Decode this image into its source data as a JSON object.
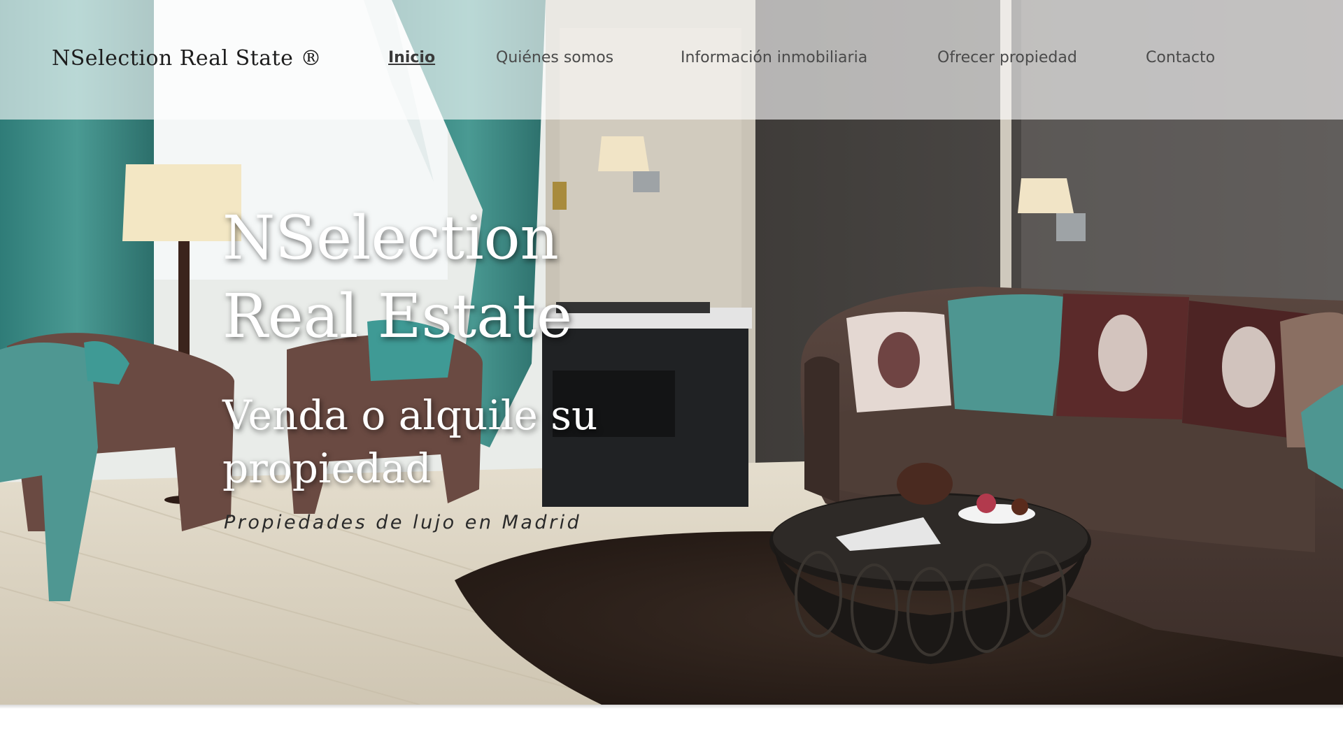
{
  "header": {
    "logo": "NSelection Real State ®",
    "nav": [
      {
        "label": "Inicio",
        "active": true
      },
      {
        "label": "Quiénes somos",
        "active": false
      },
      {
        "label": "Información inmobiliaria",
        "active": false
      },
      {
        "label": "Ofrecer propiedad",
        "active": false
      },
      {
        "label": "Contacto",
        "active": false
      }
    ]
  },
  "hero": {
    "title_line1": "NSelection",
    "title_line2": "Real Estate",
    "subtitle": "Venda o alquile su propiedad",
    "tagline": "Propiedades de lujo en Madrid"
  },
  "colors": {
    "header_bg": "#ffffff",
    "text_dark": "#1d1d1d",
    "nav_text": "#4a4a4a",
    "hero_text": "#ffffff"
  }
}
